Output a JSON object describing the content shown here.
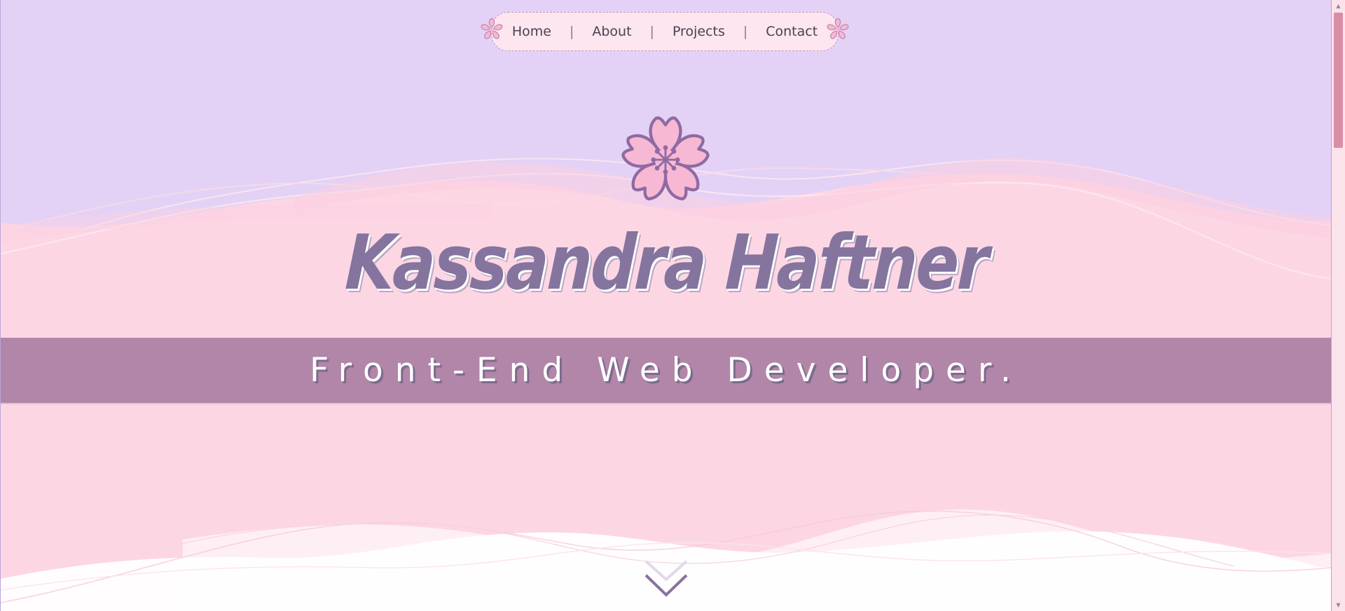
{
  "nav": {
    "links": [
      {
        "label": "Home"
      },
      {
        "label": "About"
      },
      {
        "label": "Projects"
      },
      {
        "label": "Contact"
      }
    ],
    "separator": "|",
    "decoration_icon": "cherry-blossom-icon"
  },
  "hero": {
    "icon": "cherry-blossom-icon",
    "name": "Kassandra Haftner",
    "tagline": "Front-End Web Developer."
  },
  "scroll_cue": {
    "icon": "double-chevron-down-icon"
  },
  "scrollbar": {
    "up_icon": "▲",
    "down_icon": "▼"
  },
  "colors": {
    "sky": "#e4d2f6",
    "hill_pink": "#fdd6e4",
    "tagline_band": "#b286a8",
    "title_purple": "#84749e",
    "nav_bg": "#fde6ef",
    "flower_fill": "#f7b8d4",
    "flower_outline": "#8f6aa3",
    "scroll_thumb": "#d98ea8",
    "white_wave": "#ffffff"
  }
}
